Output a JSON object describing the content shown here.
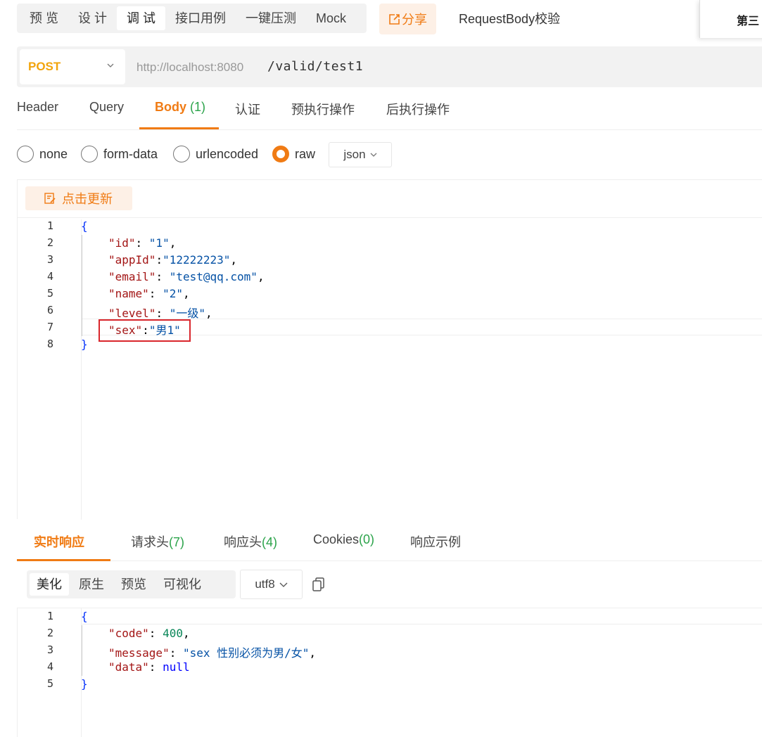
{
  "top": {
    "mode_tabs": [
      "预 览",
      "设 计",
      "调 试",
      "接口用例",
      "一键压测",
      "Mock"
    ],
    "active_mode": "调 试",
    "share_label": "分享",
    "request_name": "RequestBody校验",
    "panel_text": "第三"
  },
  "url": {
    "method": "POST",
    "host": "http://localhost:8080",
    "path": "/valid/test1"
  },
  "request_tabs": {
    "header": "Header",
    "query": "Query",
    "body": "Body",
    "body_count": "(1)",
    "auth": "认证",
    "pre": "预执行操作",
    "post": "后执行操作"
  },
  "body_types": {
    "none": "none",
    "form_data": "form-data",
    "urlencoded": "urlencoded",
    "raw": "raw",
    "selected": "raw",
    "format": "json"
  },
  "editor": {
    "update_label": "点击更新",
    "line_numbers": [
      "1",
      "2",
      "3",
      "4",
      "5",
      "6",
      "7",
      "8"
    ],
    "lines": {
      "open": "{",
      "id_key": "\"id\"",
      "id_val": "\"1\"",
      "appid_key": "\"appId\"",
      "appid_val": "\"12222223\"",
      "email_key": "\"email\"",
      "email_val": "\"test@qq.com\"",
      "name_key": "\"name\"",
      "name_val": "\"2\"",
      "level_key": "\"level\"",
      "level_val": "\"一级\"",
      "sex_key": "\"sex\"",
      "sex_val": "\"男1\"",
      "close": "}"
    }
  },
  "response_tabs": {
    "live": "实时响应",
    "req_headers": "请求头",
    "req_headers_count": "(7)",
    "resp_headers": "响应头",
    "resp_headers_count": "(4)",
    "cookies": "Cookies",
    "cookies_count": "(0)",
    "example": "响应示例"
  },
  "view_tabs": [
    "美化",
    "原生",
    "预览",
    "可视化"
  ],
  "encoding": "utf8",
  "response": {
    "line_numbers": [
      "1",
      "2",
      "3",
      "4",
      "5"
    ],
    "open": "{",
    "code_key": "\"code\"",
    "code_val": "400",
    "message_key": "\"message\"",
    "message_val": "\"sex 性别必须为男/女\"",
    "data_key": "\"data\"",
    "data_val": "null",
    "close": "}"
  },
  "colors": {
    "accent": "#f07b14",
    "method": "#f2a40c",
    "count_green": "#2ba34a",
    "highlight_box": "#d9262c"
  }
}
